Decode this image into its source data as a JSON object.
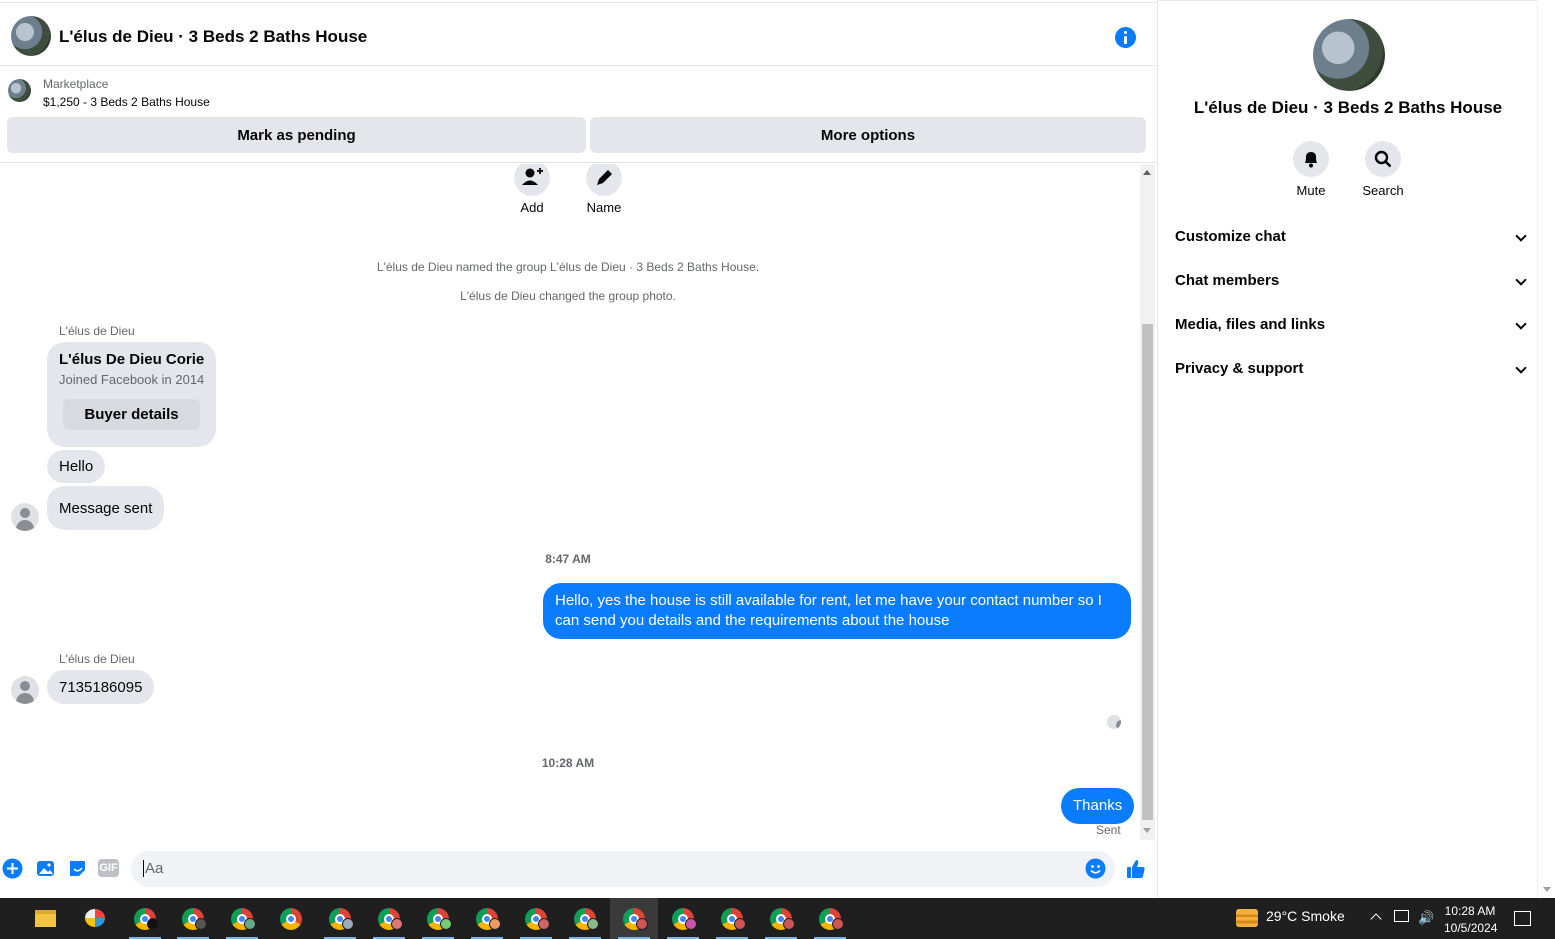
{
  "header": {
    "title": "L'élus de Dieu · 3 Beds 2 Baths House"
  },
  "marketplace": {
    "label": "Marketplace",
    "item": "$1,250 - 3 Beds 2 Baths House",
    "mark_pending": "Mark as pending",
    "more_options": "More options"
  },
  "thread": {
    "actions": {
      "add": "Add",
      "name": "Name"
    },
    "system": [
      "L'élus de Dieu named the group L'élus de Dieu · 3 Beds 2 Baths House.",
      "L'élus de Dieu changed the group photo."
    ],
    "sender_name": "L'élus de Dieu",
    "card": {
      "name": "L'élus De Dieu Corie",
      "sub": "Joined Facebook in 2014",
      "button": "Buyer details"
    },
    "msg_hello": "Hello",
    "msg_sent": "Message sent",
    "time1": "8:47 AM",
    "reply": "Hello, yes the house is still available for rent, let me have your contact number so I can send you details and the requirements about the house",
    "phone": "7135186095",
    "time2": "10:28 AM",
    "thanks": "Thanks",
    "status": "Sent"
  },
  "composer": {
    "placeholder": "Aa",
    "gif": "GIF"
  },
  "sidebar": {
    "title": "L'élus de Dieu · 3 Beds 2 Baths House",
    "mute": "Mute",
    "search": "Search",
    "sections": [
      "Customize chat",
      "Chat members",
      "Media, files and links",
      "Privacy & support"
    ]
  },
  "taskbar": {
    "weather": "29°C  Smoke",
    "time": "10:28 AM",
    "date": "10/5/2024"
  },
  "colors": {
    "accent": "#0a7cff",
    "bubble_in": "#e4e6eb",
    "taskbar": "#1f1f1f"
  },
  "icons": [
    "info-icon",
    "add-person-icon",
    "pencil-icon",
    "plus-icon",
    "image-icon",
    "sticker-icon",
    "gif-icon",
    "emoji-icon",
    "like-icon",
    "bell-icon",
    "search-icon",
    "chevron-down-icon",
    "chrome-icon",
    "folder-icon"
  ]
}
